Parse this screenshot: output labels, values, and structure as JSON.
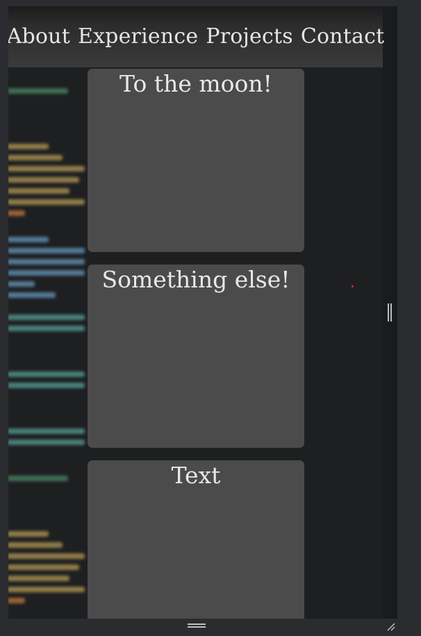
{
  "nav": {
    "items": [
      {
        "label": "About"
      },
      {
        "label": "Experience"
      },
      {
        "label": "Projects"
      },
      {
        "label": "Contact"
      }
    ]
  },
  "cards": [
    {
      "title": "To the moon!"
    },
    {
      "title": "Something else!"
    },
    {
      "title": "Text"
    }
  ],
  "colors": {
    "card_bg": "#4b4b4b",
    "page_bg": "#1e1f21",
    "nav_text": "#e6e6e6",
    "frame_bg": "#2b2c2f"
  },
  "icons": {
    "resize_right": "vertical-resize-handle-icon",
    "resize_bottom": "horizontal-resize-handle-icon",
    "corner": "resize-corner-icon"
  }
}
